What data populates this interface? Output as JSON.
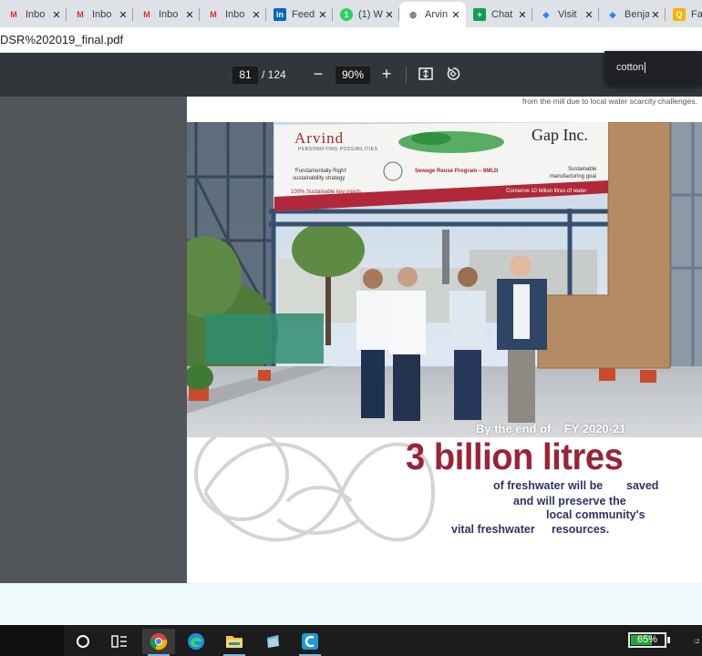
{
  "browser": {
    "tabs": [
      {
        "title": "Inbo",
        "icon": "gmail-icon",
        "glyph": "M",
        "variant": "gmail"
      },
      {
        "title": "Inbo",
        "icon": "gmail-icon",
        "glyph": "M",
        "variant": "gmail"
      },
      {
        "title": "Inbo",
        "icon": "gmail-icon",
        "glyph": "M",
        "variant": "gmail"
      },
      {
        "title": "Inbo",
        "icon": "gmail-icon",
        "glyph": "M",
        "variant": "gmail"
      },
      {
        "title": "Feed",
        "icon": "linkedin-icon",
        "glyph": "in",
        "variant": "linkedin"
      },
      {
        "title": "(1) W",
        "icon": "whatsapp-icon",
        "glyph": "1",
        "variant": "whatsapp"
      },
      {
        "title": "Arvin",
        "icon": "globe-icon",
        "glyph": "◍",
        "variant": "globe",
        "active": true
      },
      {
        "title": "Chat",
        "icon": "chat-icon",
        "glyph": "+",
        "variant": "chat"
      },
      {
        "title": "Visit",
        "icon": "jira-icon",
        "glyph": "◆",
        "variant": "jira"
      },
      {
        "title": "Benja",
        "icon": "jira-icon",
        "glyph": "◆",
        "variant": "jira"
      },
      {
        "title": "Fa",
        "icon": "fa-icon",
        "glyph": "Q",
        "variant": "fa"
      }
    ],
    "close_glyph": "✕",
    "url": "DSR%202019_final.pdf"
  },
  "pdf_toolbar": {
    "page_current": "81",
    "page_total": "/ 124",
    "zoom_minus": "−",
    "zoom": "90%",
    "zoom_plus": "+",
    "find_query": "cotton"
  },
  "page": {
    "prev_text": "from the mill due to local water scarcity challenges.",
    "banner": {
      "arvind": "Arvind",
      "arvind_tag": "PERSONIFYING POSSIBILITIES",
      "gap": "Gap Inc.",
      "fundamentally": "'Fundamentally Right'",
      "strategy": "sustainability strategy",
      "program": "Sewage Reuse Program – 8MLD",
      "sustainable": "Sustainable",
      "manufacturing": "manufacturing goal",
      "inputs": "100% Sustainable key inputs",
      "conserve": "Conserve 10 billion litres of water"
    },
    "by_end": "By the end of",
    "fy": "FY 2020-21",
    "headline": "3 billion litres",
    "lines": [
      "of freshwater will be",
      "saved",
      "and will preserve the",
      "local community's",
      "vital freshwater",
      "resources."
    ]
  },
  "taskbar": {
    "battery": "65%",
    "battery_level": 0.65,
    "tray_char": "ය"
  },
  "colors": {
    "accent_red": "#9b2335",
    "navy_text": "#2e3266",
    "battery_green": "#22a538"
  }
}
